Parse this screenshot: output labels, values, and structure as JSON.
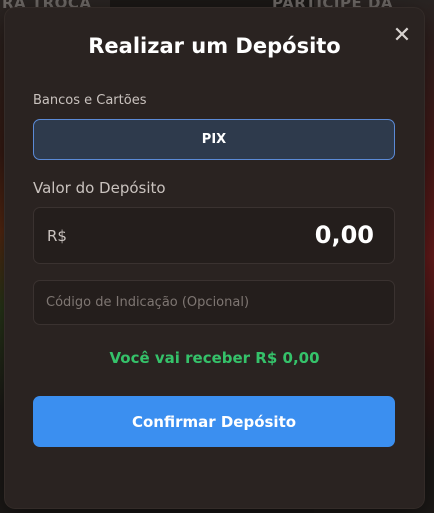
{
  "background": {
    "left_text": "RA TROCA",
    "right_text": "PARTICIPE DA RIFA"
  },
  "modal": {
    "title": "Realizar um Depósito",
    "close_icon": "close-icon",
    "banks_label": "Bancos e Cartões",
    "payment_method": "PIX",
    "value_label": "Valor do Depósito",
    "currency": "R$",
    "amount": "0,00",
    "referral_placeholder": "Código de Indicação (Opcional)",
    "receive_text": "Você vai receber R$ 0,00",
    "confirm_label": "Confirmar Depósito"
  },
  "colors": {
    "accent": "#3b8ff0",
    "success": "#35c26a",
    "modal_bg": "#2a2321"
  }
}
